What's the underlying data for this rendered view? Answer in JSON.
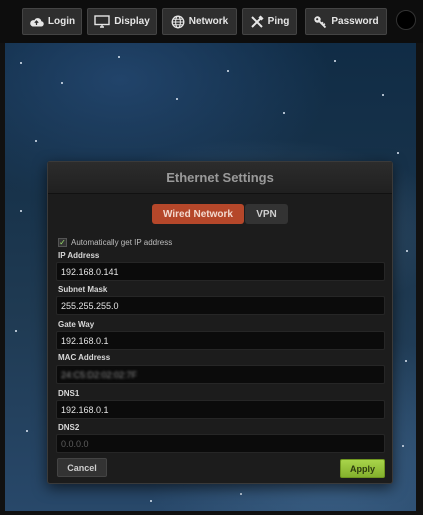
{
  "toolbar": {
    "buttons": [
      {
        "label": "Login",
        "icon": "cloud-upload-icon"
      },
      {
        "label": "Display",
        "icon": "monitor-icon"
      },
      {
        "label": "Network",
        "icon": "globe-icon"
      },
      {
        "label": "Ping",
        "icon": "tools-icon"
      },
      {
        "label": "Password",
        "icon": "key-icon"
      }
    ]
  },
  "dialog": {
    "title": "Ethernet Settings",
    "tabs": [
      {
        "label": "Wired Network",
        "active": true
      },
      {
        "label": "VPN",
        "active": false
      }
    ],
    "auto_ip": {
      "label": "Automatically get IP address",
      "checked": true
    },
    "fields": {
      "ip": {
        "label": "IP Address",
        "value": "192.168.0.141"
      },
      "subnet": {
        "label": "Subnet Mask",
        "value": "255.255.255.0"
      },
      "gateway": {
        "label": "Gate Way",
        "value": "192.168.0.1"
      },
      "mac": {
        "label": "MAC Address",
        "value": "24:C5:D2:02:02:7F"
      },
      "dns1": {
        "label": "DNS1",
        "value": "192.168.0.1"
      },
      "dns2": {
        "label": "DNS2",
        "value": "0.0.0.0"
      }
    },
    "cancel_label": "Cancel",
    "apply_label": "Apply"
  },
  "colors": {
    "active_tab": "#b5472a",
    "apply_button": "#a8d44a",
    "toolbar_bg": "#0d0d0d",
    "dialog_bg": "#1c1c1c"
  }
}
